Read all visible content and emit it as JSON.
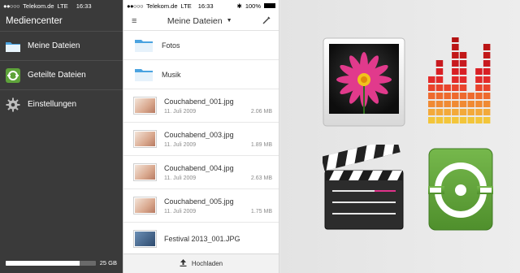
{
  "sidebar": {
    "status": {
      "carrier": "Telekom.de",
      "network": "LTE",
      "time": "16:33"
    },
    "title": "Mediencenter",
    "items": [
      {
        "label": "Meine Dateien",
        "icon": "folder-icon"
      },
      {
        "label": "Geteilte Dateien",
        "icon": "share-icon"
      },
      {
        "label": "Einstellungen",
        "icon": "gear-icon"
      }
    ],
    "storage": {
      "label": "25 GB",
      "used_fraction": 0.82
    }
  },
  "filelist": {
    "status": {
      "carrier": "Telekom.de",
      "network": "LTE",
      "time": "16:33",
      "battery": "100%"
    },
    "title": "Meine Dateien",
    "folders": [
      {
        "name": "Fotos"
      },
      {
        "name": "Musik"
      }
    ],
    "files": [
      {
        "name": "Couchabend_001.jpg",
        "date": "11. Juli 2009",
        "size": "2.06 MB"
      },
      {
        "name": "Couchabend_003.jpg",
        "date": "11. Juli 2009",
        "size": "1.89 MB"
      },
      {
        "name": "Couchabend_004.jpg",
        "date": "11. Juli 2009",
        "size": "2.63 MB"
      },
      {
        "name": "Couchabend_005.jpg",
        "date": "11. Juli 2009",
        "size": "1.75 MB"
      },
      {
        "name": "Festival 2013_001.JPG",
        "date": "",
        "size": ""
      }
    ],
    "upload_label": "Hochladen"
  },
  "tiles": [
    {
      "name": "photos-app-icon"
    },
    {
      "name": "music-app-icon"
    },
    {
      "name": "video-app-icon"
    },
    {
      "name": "share-app-icon"
    }
  ],
  "colors": {
    "sidebar_bg": "#3a3a3a",
    "folder_blue": "#4aa3e0",
    "share_green": "#5ea33a"
  }
}
